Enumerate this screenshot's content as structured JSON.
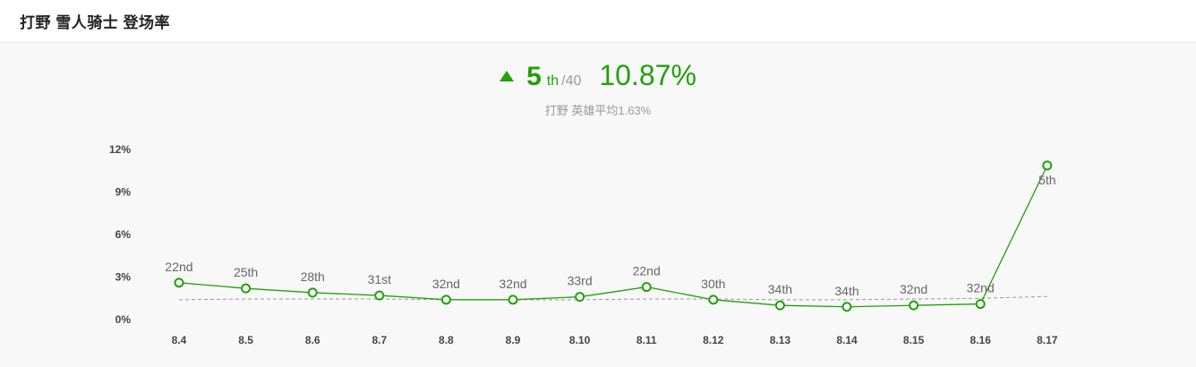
{
  "header": {
    "title": "打野 雪人骑士 登场率"
  },
  "summary": {
    "rank": "5",
    "rank_suffix": "th",
    "rank_total": "/40",
    "rate": "10.87%",
    "average": "打野 英雄平均1.63%"
  },
  "colors": {
    "accent": "#21a10a",
    "average_line": "#999999"
  },
  "icons": {
    "trend": "up-triangle-icon"
  },
  "chart_data": {
    "type": "line",
    "categories": [
      "8.4",
      "8.5",
      "8.6",
      "8.7",
      "8.8",
      "8.9",
      "8.10",
      "8.11",
      "8.12",
      "8.13",
      "8.14",
      "8.15",
      "8.16",
      "8.17"
    ],
    "series": [
      {
        "values": [
          2.6,
          2.2,
          1.9,
          1.7,
          1.4,
          1.4,
          1.6,
          2.3,
          1.4,
          1.0,
          0.9,
          1.0,
          1.1,
          10.87
        ],
        "point_labels": [
          "22nd",
          "25th",
          "28th",
          "31st",
          "32nd",
          "32nd",
          "33rd",
          "22nd",
          "30th",
          "34th",
          "34th",
          "32nd",
          "32nd",
          "5th"
        ]
      }
    ],
    "average_line": [
      1.4,
      1.45,
      1.45,
      1.45,
      1.4,
      1.4,
      1.4,
      1.45,
      1.45,
      1.4,
      1.4,
      1.45,
      1.5,
      1.63
    ],
    "y_ticks": [
      "0%",
      "3%",
      "6%",
      "9%",
      "12%"
    ],
    "ylim": [
      0,
      12
    ],
    "grid": false
  }
}
